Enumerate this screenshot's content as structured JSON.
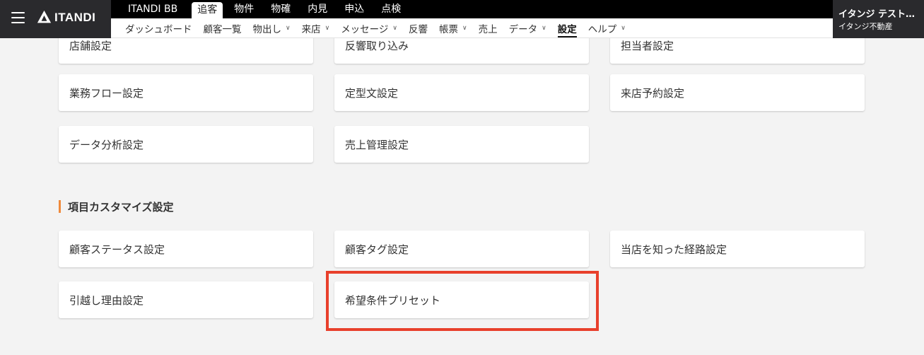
{
  "header": {
    "logo_text": "ITANDI",
    "top_tabs": [
      {
        "label": "ITANDI BB"
      },
      {
        "label": "追客"
      },
      {
        "label": "物件"
      },
      {
        "label": "物確"
      },
      {
        "label": "内見"
      },
      {
        "label": "申込"
      },
      {
        "label": "点検"
      }
    ],
    "sub_nav": [
      {
        "label": "ダッシュボード"
      },
      {
        "label": "顧客一覧"
      },
      {
        "label": "物出し"
      },
      {
        "label": "来店"
      },
      {
        "label": "メッセージ"
      },
      {
        "label": "反響"
      },
      {
        "label": "帳票"
      },
      {
        "label": "売上"
      },
      {
        "label": "データ"
      },
      {
        "label": "設定"
      },
      {
        "label": "ヘルプ"
      }
    ],
    "user": {
      "name": "イタンジ テスト…",
      "company": "イタンジ不動産"
    }
  },
  "settings_cards": [
    {
      "label": "店舗設定"
    },
    {
      "label": "反響取り込み"
    },
    {
      "label": "担当者設定"
    },
    {
      "label": "業務フロー設定"
    },
    {
      "label": "定型文設定"
    },
    {
      "label": "来店予約設定"
    },
    {
      "label": "データ分析設定"
    },
    {
      "label": "売上管理設定"
    }
  ],
  "section": {
    "title": "項目カスタマイズ設定"
  },
  "custom_cards": [
    {
      "label": "顧客ステータス設定"
    },
    {
      "label": "顧客タグ設定"
    },
    {
      "label": "当店を知った経路設定"
    },
    {
      "label": "引越し理由設定"
    },
    {
      "label": "希望条件プリセット"
    }
  ],
  "colors": {
    "accent_bar": "#ef8a3c",
    "highlight_border": "#e8402c"
  }
}
